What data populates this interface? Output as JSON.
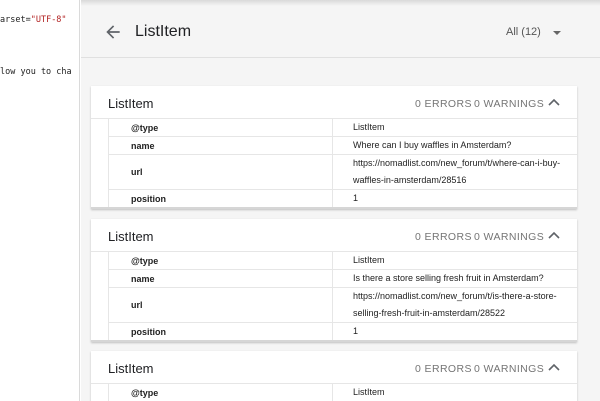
{
  "code": {
    "line1_prefix": "arset=",
    "line1_string": "\"UTF-8\"",
    "line2": "low you to cha"
  },
  "header": {
    "title": "ListItem",
    "filter_label": "All (12)",
    "back_icon": "arrow-back-icon",
    "dropdown_icon": "caret-down-icon"
  },
  "cards": [
    {
      "title": "ListItem",
      "errors": "0 ERRORS",
      "warnings": "0 WARNINGS",
      "rows": [
        {
          "key": "@type",
          "value": "ListItem"
        },
        {
          "key": "name",
          "value": "Where can I buy waffles in Amsterdam?"
        },
        {
          "key": "url",
          "value_line1": "https://nomadlist.com/new_forum/t/where-can-i-buy-",
          "value_line2": "waffles-in-amsterdam/28516"
        },
        {
          "key": "position",
          "value": "1"
        }
      ]
    },
    {
      "title": "ListItem",
      "errors": "0 ERRORS",
      "warnings": "0 WARNINGS",
      "rows": [
        {
          "key": "@type",
          "value": "ListItem"
        },
        {
          "key": "name",
          "value": "Is there a store selling fresh fruit in Amsterdam?"
        },
        {
          "key": "url",
          "value_line1": "https://nomadlist.com/new_forum/t/is-there-a-store-",
          "value_line2": "selling-fresh-fruit-in-amsterdam/28522"
        },
        {
          "key": "position",
          "value": "1"
        }
      ]
    },
    {
      "title": "ListItem",
      "errors": "0 ERRORS",
      "warnings": "0 WARNINGS",
      "rows": [
        {
          "key": "@type",
          "value": "ListItem"
        }
      ]
    }
  ],
  "colors": {
    "panel_bg": "#f5f5f5",
    "card_bg": "#ffffff",
    "muted_text": "#757575",
    "code_string": "#b22222"
  }
}
